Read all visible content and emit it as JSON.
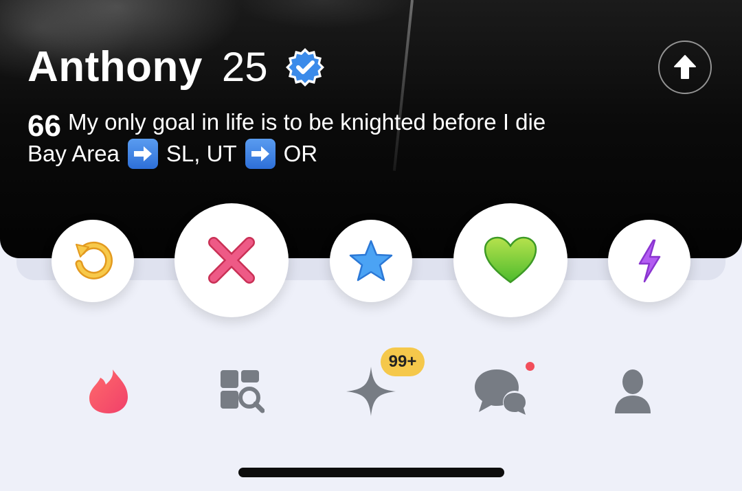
{
  "profile": {
    "name": "Anthony",
    "age": "25",
    "bio_line1": "My only goal in life is to be knighted before I die",
    "bio_line2_part1": "Bay Area",
    "bio_line2_part2": "SL, UT",
    "bio_line2_part3": "OR",
    "quote_mark": "66"
  },
  "actions": [
    {
      "name": "rewind",
      "icon": "rewind-icon",
      "color": "#f0b23a"
    },
    {
      "name": "nope",
      "icon": "close-icon",
      "color": "#e8476d"
    },
    {
      "name": "super-like",
      "icon": "star-icon",
      "color": "#3d8fe8"
    },
    {
      "name": "like",
      "icon": "heart-icon",
      "color": "#7bd13c"
    },
    {
      "name": "boost",
      "icon": "lightning-icon",
      "color": "#a54ae8"
    }
  ],
  "nav": {
    "items": [
      "flame-icon",
      "explore-icon",
      "sparkle-icon",
      "chat-icon",
      "profile-icon"
    ],
    "badge": "99+",
    "active_color": "#f15e5e",
    "inactive_color": "#7b8088"
  }
}
